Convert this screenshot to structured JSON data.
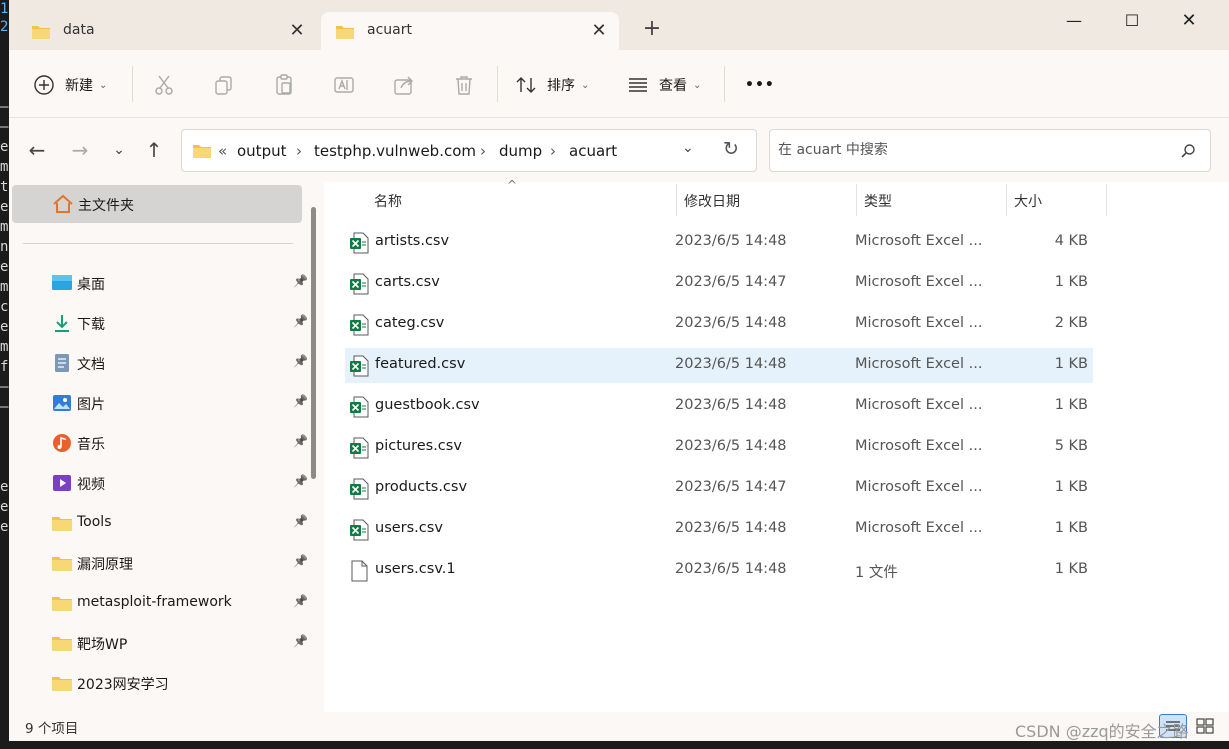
{
  "window": {
    "tabs": [
      {
        "label": "data",
        "active": false
      },
      {
        "label": "acuart",
        "active": true
      }
    ],
    "new_tab_glyph": "+",
    "controls": {
      "minimize": "—",
      "maximize": "☐",
      "close": "✕"
    }
  },
  "toolbar": {
    "new_label": "新建",
    "sort_label": "排序",
    "view_label": "查看",
    "more_label": "•••",
    "icons": [
      "cut-icon",
      "copy-icon",
      "paste-icon",
      "rename-icon",
      "share-icon",
      "delete-icon"
    ]
  },
  "address": {
    "overflow": "«",
    "crumbs": [
      "output",
      "testphp.vulnweb.com",
      "dump",
      "acuart"
    ],
    "separator": "›"
  },
  "search": {
    "placeholder": "在 acuart 中搜索"
  },
  "sidebar": {
    "home_label": "主文件夹",
    "items": [
      {
        "label": "桌面",
        "icon": "desktop-icon",
        "pinned": true
      },
      {
        "label": "下载",
        "icon": "download-icon",
        "pinned": true
      },
      {
        "label": "文档",
        "icon": "document-icon",
        "pinned": true
      },
      {
        "label": "图片",
        "icon": "picture-icon",
        "pinned": true
      },
      {
        "label": "音乐",
        "icon": "music-icon",
        "pinned": true
      },
      {
        "label": "视频",
        "icon": "video-icon",
        "pinned": true
      },
      {
        "label": "Tools",
        "icon": "folder-icon",
        "pinned": true
      },
      {
        "label": "漏洞原理",
        "icon": "folder-icon",
        "pinned": true
      },
      {
        "label": "metasploit-framework",
        "icon": "folder-icon",
        "pinned": true
      },
      {
        "label": "靶场WP",
        "icon": "folder-icon",
        "pinned": true
      },
      {
        "label": "2023网安学习",
        "icon": "folder-icon",
        "pinned": false
      }
    ]
  },
  "columns": {
    "name": "名称",
    "date": "修改日期",
    "type": "类型",
    "size": "大小"
  },
  "files": [
    {
      "name": "artists.csv",
      "date": "2023/6/5 14:48",
      "type": "Microsoft Excel ...",
      "size": "4 KB",
      "kind": "excel",
      "selected": false
    },
    {
      "name": "carts.csv",
      "date": "2023/6/5 14:47",
      "type": "Microsoft Excel ...",
      "size": "1 KB",
      "kind": "excel",
      "selected": false
    },
    {
      "name": "categ.csv",
      "date": "2023/6/5 14:48",
      "type": "Microsoft Excel ...",
      "size": "2 KB",
      "kind": "excel",
      "selected": false
    },
    {
      "name": "featured.csv",
      "date": "2023/6/5 14:48",
      "type": "Microsoft Excel ...",
      "size": "1 KB",
      "kind": "excel",
      "selected": true
    },
    {
      "name": "guestbook.csv",
      "date": "2023/6/5 14:48",
      "type": "Microsoft Excel ...",
      "size": "1 KB",
      "kind": "excel",
      "selected": false
    },
    {
      "name": "pictures.csv",
      "date": "2023/6/5 14:48",
      "type": "Microsoft Excel ...",
      "size": "5 KB",
      "kind": "excel",
      "selected": false
    },
    {
      "name": "products.csv",
      "date": "2023/6/5 14:47",
      "type": "Microsoft Excel ...",
      "size": "1 KB",
      "kind": "excel",
      "selected": false
    },
    {
      "name": "users.csv",
      "date": "2023/6/5 14:48",
      "type": "Microsoft Excel ...",
      "size": "1 KB",
      "kind": "excel",
      "selected": false
    },
    {
      "name": "users.csv.1",
      "date": "2023/6/5 14:48",
      "type": "1 文件",
      "size": "1 KB",
      "kind": "file",
      "selected": false
    }
  ],
  "status": {
    "item_count": "9 个项目"
  },
  "watermark": "CSDN @zzq的安全之路",
  "terminal_chars": [
    "1",
    "2",
    "—",
    "—",
    "e",
    "m",
    "t",
    "e",
    "m",
    "n",
    "e",
    "m",
    "c",
    "e",
    "m",
    "f",
    "—",
    "—",
    "e",
    "e",
    "e"
  ],
  "colors": {
    "accent": "#0067c0",
    "selected_row": "#e5f1fb",
    "excel_green": "#107c41",
    "folder_yellow": "#f4c24a"
  }
}
